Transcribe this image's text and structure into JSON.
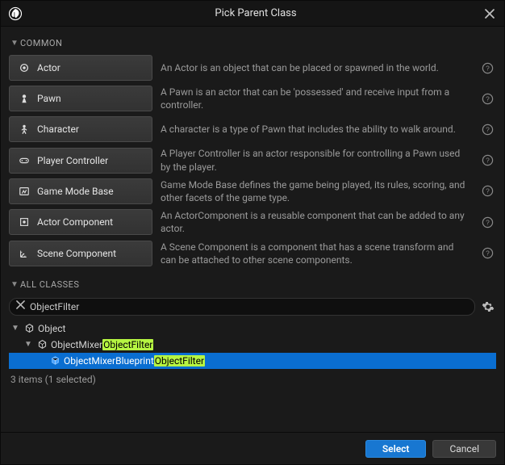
{
  "titlebar": {
    "title": "Pick Parent Class"
  },
  "sections": {
    "common_label": "COMMON",
    "all_classes_label": "ALL CLASSES"
  },
  "common_classes": [
    {
      "icon": "actor-icon",
      "name": "Actor",
      "desc": "An Actor is an object that can be placed or spawned in the world."
    },
    {
      "icon": "pawn-icon",
      "name": "Pawn",
      "desc": "A Pawn is an actor that can be 'possessed' and receive input from a controller."
    },
    {
      "icon": "character-icon",
      "name": "Character",
      "desc": "A character is a type of Pawn that includes the ability to walk around."
    },
    {
      "icon": "player-controller-icon",
      "name": "Player Controller",
      "desc": "A Player Controller is an actor responsible for controlling a Pawn used by the player."
    },
    {
      "icon": "game-mode-icon",
      "name": "Game Mode Base",
      "desc": "Game Mode Base defines the game being played, its rules, scoring, and other facets of the game type."
    },
    {
      "icon": "actor-component-icon",
      "name": "Actor Component",
      "desc": "An ActorComponent is a reusable component that can be added to any actor."
    },
    {
      "icon": "scene-component-icon",
      "name": "Scene Component",
      "desc": "A Scene Component is a component that has a scene transform and can be attached to other scene components."
    }
  ],
  "search": {
    "value": "ObjectFilter"
  },
  "tree": [
    {
      "level": 0,
      "label_pre": "Object",
      "label_hl": "",
      "selected": false,
      "icon": "class-icon",
      "expandable": true
    },
    {
      "level": 1,
      "label_pre": "ObjectMixer",
      "label_hl": "ObjectFilter",
      "selected": false,
      "icon": "class-icon",
      "expandable": true
    },
    {
      "level": 2,
      "label_pre": "ObjectMixerBlueprint",
      "label_hl": "ObjectFilter",
      "selected": true,
      "icon": "blueprint-class-icon",
      "expandable": false
    }
  ],
  "status": "3 items (1 selected)",
  "footer": {
    "select": "Select",
    "cancel": "Cancel"
  }
}
